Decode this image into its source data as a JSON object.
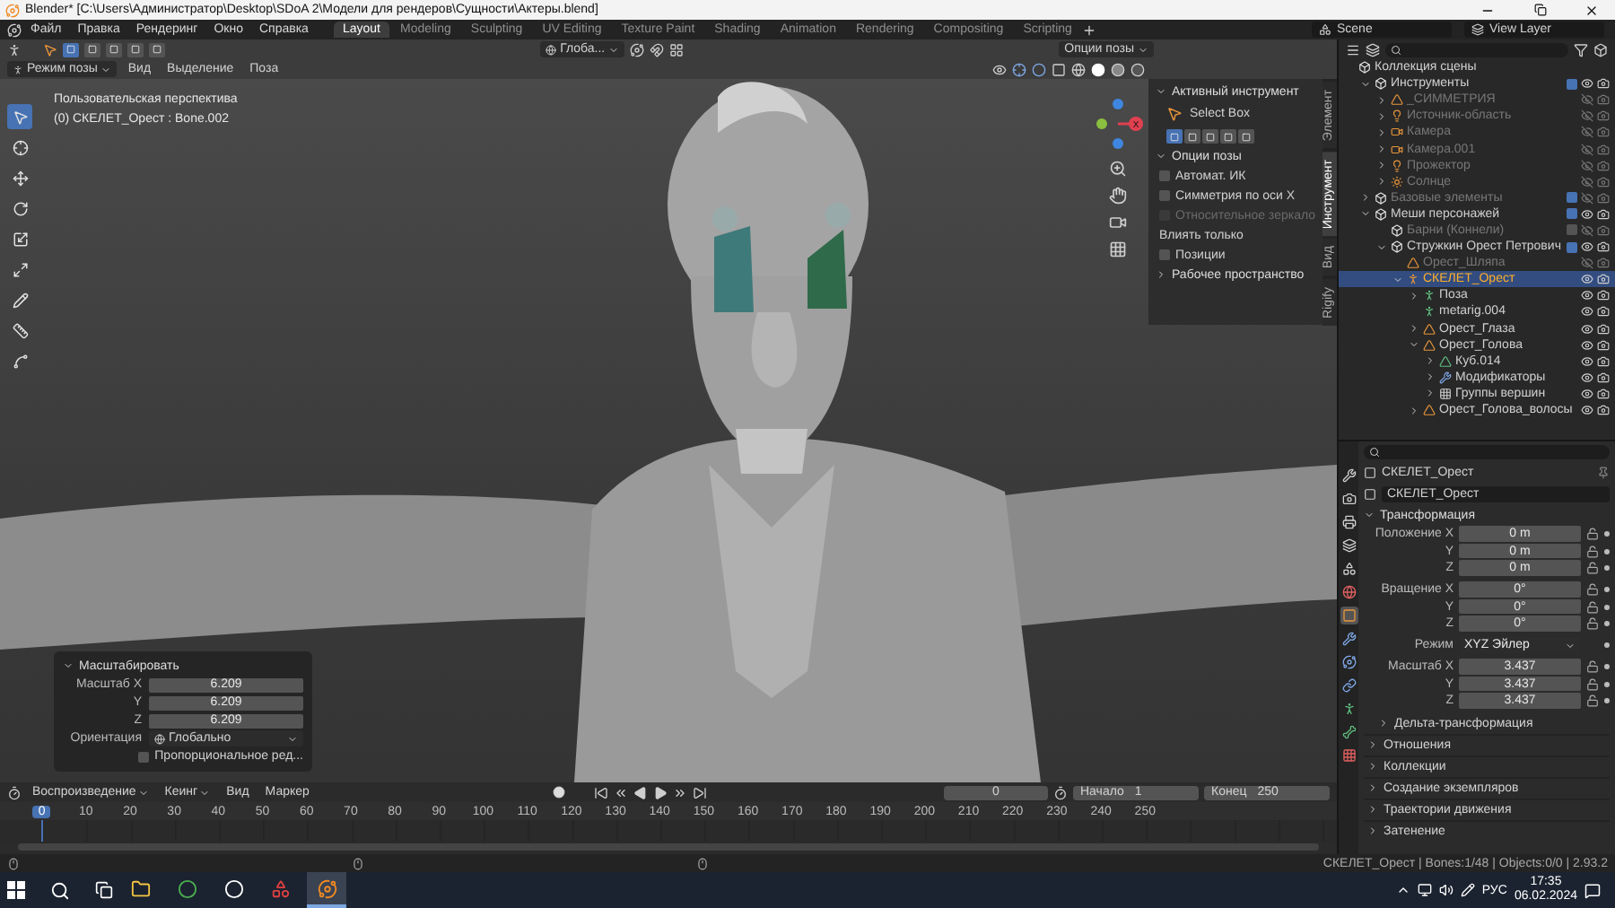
{
  "window": {
    "title": "Blender* [C:\\Users\\Администратор\\Desktop\\SDoA 2\\Модели для рендеров\\Сущности\\Актеры.blend]"
  },
  "menu": [
    "Файл",
    "Правка",
    "Рендеринг",
    "Окно",
    "Справка"
  ],
  "workspaces": [
    {
      "label": "Layout",
      "selected": true
    },
    {
      "label": "Modeling",
      "selected": false
    },
    {
      "label": "Sculpting",
      "selected": false
    },
    {
      "label": "UV Editing",
      "selected": false
    },
    {
      "label": "Texture Paint",
      "selected": false
    },
    {
      "label": "Shading",
      "selected": false
    },
    {
      "label": "Animation",
      "selected": false
    },
    {
      "label": "Rendering",
      "selected": false
    },
    {
      "label": "Compositing",
      "selected": false
    },
    {
      "label": "Scripting",
      "selected": false
    }
  ],
  "scene": "Scene",
  "view_layer": "View Layer",
  "viewport": {
    "select_modes": [
      {
        "selected": true
      },
      {
        "selected": false
      },
      {
        "selected": false
      },
      {
        "selected": false
      },
      {
        "selected": false
      }
    ],
    "orientation": "Глоба...",
    "pose_options": "Опции позы",
    "mode": "Режим позы",
    "menus": [
      "Вид",
      "Выделение",
      "Поза"
    ],
    "overlay_lines": [
      "Пользовательская перспектива",
      "(0) СКЕЛЕТ_Орест : Bone.002"
    ],
    "tools": [
      {
        "kind": "select",
        "selected": true
      },
      {
        "kind": "cursor",
        "selected": false
      },
      {
        "kind": "move",
        "selected": false
      },
      {
        "kind": "rotate",
        "selected": false
      },
      {
        "kind": "scale",
        "selected": false
      },
      {
        "kind": "transform",
        "selected": false
      },
      {
        "kind": "annotate",
        "selected": false
      },
      {
        "kind": "measure",
        "selected": false
      },
      {
        "kind": "roll",
        "selected": false
      }
    ],
    "gizmo_label": "X"
  },
  "sidebar": {
    "tabs": [
      {
        "label": "Элемент",
        "selected": false
      },
      {
        "label": "Инструмент",
        "selected": true
      },
      {
        "label": "Вид",
        "selected": false
      },
      {
        "label": "Rigify",
        "selected": false
      }
    ],
    "active_tool_title": "Активный инструмент",
    "tool_name": "Select Box",
    "tool_modes": [
      {
        "selected": true
      },
      {
        "selected": false
      },
      {
        "selected": false
      },
      {
        "selected": false
      },
      {
        "selected": false
      }
    ],
    "pose_options_title": "Опции позы",
    "options": [
      {
        "kind": "checkbox",
        "label": "Автомат. ИК",
        "checked": false,
        "disabled": false
      },
      {
        "kind": "checkbox",
        "label": "Симметрия по оси X",
        "checked": false,
        "disabled": false
      },
      {
        "kind": "checkbox",
        "label": "Относительное зеркало",
        "checked": false,
        "disabled": true
      },
      {
        "kind": "label",
        "label": "Влиять только"
      },
      {
        "kind": "checkbox",
        "label": "Позиции",
        "checked": false,
        "disabled": false
      }
    ],
    "workspace_title": "Рабочее пространство"
  },
  "last_operation": {
    "title": "Масштабировать",
    "rows": [
      {
        "label": "Масштаб X",
        "value": "6.209"
      },
      {
        "label": "Y",
        "value": "6.209"
      },
      {
        "label": "Z",
        "value": "6.209"
      }
    ],
    "orientation_label": "Ориентация",
    "orientation": "Глобально",
    "proportional": {
      "label": "Пропорциональное ред...",
      "checked": false
    }
  },
  "outliner": {
    "tree": [
      {
        "kind": "collection",
        "label": "Коллекция сцены",
        "selected": false,
        "dimmed": false,
        "children": [
          {
            "kind": "collection",
            "label": "Инструменты",
            "selected": false,
            "dimmed": false,
            "expanded": true,
            "checked": true,
            "children": [
              {
                "kind": "mesh",
                "label": "_СИММЕТРИЯ",
                "selected": false,
                "dimmed": true,
                "expanded": false
              },
              {
                "kind": "light",
                "label": "Источник-область",
                "selected": false,
                "dimmed": true,
                "expanded": false
              },
              {
                "kind": "camera",
                "label": "Камера",
                "selected": false,
                "dimmed": true,
                "expanded": false
              },
              {
                "kind": "camera",
                "label": "Камера.001",
                "selected": false,
                "dimmed": true,
                "expanded": false
              },
              {
                "kind": "light",
                "label": "Прожектор",
                "selected": false,
                "dimmed": true,
                "expanded": false
              },
              {
                "kind": "sun",
                "label": "Солнце",
                "selected": false,
                "dimmed": true,
                "expanded": false
              }
            ]
          },
          {
            "kind": "collection",
            "label": "Базовые элементы",
            "selected": false,
            "dimmed": true,
            "expanded": false,
            "checked": true
          },
          {
            "kind": "collection",
            "label": "Меши персонажей",
            "selected": false,
            "dimmed": false,
            "expanded": true,
            "checked": true,
            "children": [
              {
                "kind": "collection",
                "label": "Барни (Коннели)",
                "selected": false,
                "dimmed": true,
                "checked": false
              },
              {
                "kind": "collection",
                "label": "Стружкин Орест Петрович",
                "selected": false,
                "dimmed": false,
                "expanded": true,
                "checked": true,
                "children": [
                  {
                    "kind": "mesh",
                    "label": "Орест_Шляпа",
                    "selected": false,
                    "dimmed": true
                  },
                  {
                    "kind": "armature",
                    "label": "СКЕЛЕТ_Орест",
                    "selected": true,
                    "dimmed": false,
                    "expanded": true,
                    "children": [
                      {
                        "kind": "pose",
                        "label": "Поза",
                        "selected": false,
                        "dimmed": false,
                        "expanded": false
                      },
                      {
                        "kind": "armature-data",
                        "label": "metarig.004",
                        "selected": false,
                        "dimmed": false
                      },
                      {
                        "kind": "mesh",
                        "label": "Орест_Глаза",
                        "selected": false,
                        "dimmed": false,
                        "expanded": false
                      },
                      {
                        "kind": "mesh",
                        "label": "Орест_Голова",
                        "selected": false,
                        "dimmed": false,
                        "expanded": true,
                        "children": [
                          {
                            "kind": "mesh-data",
                            "label": "Куб.014",
                            "selected": false,
                            "dimmed": false,
                            "expanded": false
                          },
                          {
                            "kind": "modifiers",
                            "label": "Модификаторы",
                            "selected": false,
                            "dimmed": false,
                            "expanded": false
                          },
                          {
                            "kind": "vertex-groups",
                            "label": "Группы вершин",
                            "selected": false,
                            "dimmed": false,
                            "expanded": false
                          }
                        ]
                      },
                      {
                        "kind": "mesh",
                        "label": "Орест_Голова_волосы",
                        "selected": false,
                        "dimmed": false,
                        "expanded": false
                      }
                    ]
                  }
                ]
              }
            ]
          }
        ]
      }
    ]
  },
  "properties": {
    "tabs": [
      {
        "kind": "tool",
        "selected": false
      },
      {
        "kind": "render",
        "selected": false
      },
      {
        "kind": "output",
        "selected": false
      },
      {
        "kind": "view-layer",
        "selected": false
      },
      {
        "kind": "scene",
        "selected": false
      },
      {
        "kind": "world",
        "selected": false
      },
      {
        "kind": "object",
        "selected": true
      },
      {
        "kind": "modifiers",
        "selected": false
      },
      {
        "kind": "physics",
        "selected": false
      },
      {
        "kind": "constraints",
        "selected": false
      },
      {
        "kind": "data",
        "selected": false
      },
      {
        "kind": "bone",
        "selected": false
      },
      {
        "kind": "texture",
        "selected": false
      }
    ],
    "object_name": "СКЕЛЕТ_Орест",
    "datablock": "СКЕЛЕТ_Орест",
    "transform_title": "Трансформация",
    "groups": [
      {
        "rows": [
          {
            "kind": "number",
            "label": "Положение X",
            "value": "0 m"
          },
          {
            "kind": "number",
            "label": "Y",
            "value": "0 m"
          },
          {
            "kind": "number",
            "label": "Z",
            "value": "0 m"
          }
        ]
      },
      {
        "rows": [
          {
            "kind": "number",
            "label": "Вращение X",
            "value": "0°"
          },
          {
            "kind": "number",
            "label": "Y",
            "value": "0°"
          },
          {
            "kind": "number",
            "label": "Z",
            "value": "0°"
          }
        ]
      },
      {
        "rows": [
          {
            "kind": "dropdown",
            "label": "Режим",
            "value": "XYZ Эйлер"
          }
        ]
      },
      {
        "rows": [
          {
            "kind": "number",
            "label": "Масштаб X",
            "value": "3.437"
          },
          {
            "kind": "number",
            "label": "Y",
            "value": "3.437"
          },
          {
            "kind": "number",
            "label": "Z",
            "value": "3.437"
          }
        ]
      }
    ],
    "subpanel": "Дельта-трансформация",
    "panels": [
      "Отношения",
      "Коллекции",
      "Создание экземпляров",
      "Траектории движения",
      "Затенение"
    ]
  },
  "timeline": {
    "menus": [
      {
        "label": "Воспроизведение",
        "dropdown": true
      },
      {
        "label": "Кеинг",
        "dropdown": true
      },
      {
        "label": "Вид",
        "dropdown": false
      },
      {
        "label": "Маркер",
        "dropdown": false
      }
    ],
    "current_frame": "0",
    "start_label": "Начало",
    "start": "1",
    "end_label": "Конец",
    "end": "250",
    "ruler": [
      {
        "label": "0",
        "selected": true
      },
      {
        "label": "10",
        "selected": false
      },
      {
        "label": "20",
        "selected": false
      },
      {
        "label": "30",
        "selected": false
      },
      {
        "label": "40",
        "selected": false
      },
      {
        "label": "50",
        "selected": false
      },
      {
        "label": "60",
        "selected": false
      },
      {
        "label": "70",
        "selected": false
      },
      {
        "label": "80",
        "selected": false
      },
      {
        "label": "90",
        "selected": false
      },
      {
        "label": "100",
        "selected": false
      },
      {
        "label": "110",
        "selected": false
      },
      {
        "label": "120",
        "selected": false
      },
      {
        "label": "130",
        "selected": false
      },
      {
        "label": "140",
        "selected": false
      },
      {
        "label": "150",
        "selected": false
      },
      {
        "label": "160",
        "selected": false
      },
      {
        "label": "170",
        "selected": false
      },
      {
        "label": "180",
        "selected": false
      },
      {
        "label": "190",
        "selected": false
      },
      {
        "label": "200",
        "selected": false
      },
      {
        "label": "210",
        "selected": false
      },
      {
        "label": "220",
        "selected": false
      },
      {
        "label": "230",
        "selected": false
      },
      {
        "label": "240",
        "selected": false
      },
      {
        "label": "250",
        "selected": false
      }
    ]
  },
  "status_bar": {
    "text": "СКЕЛЕТ_Орест | Bones:1/48 | Objects:0/0 | 2.93.2"
  },
  "taskbar": {
    "apps": [
      {
        "kind": "explorer",
        "active": false
      },
      {
        "kind": "browser",
        "active": false
      },
      {
        "kind": "engine",
        "active": false
      },
      {
        "kind": "app",
        "active": false
      },
      {
        "kind": "blender",
        "active": true
      }
    ],
    "language": "РУС",
    "time": "17:35",
    "date": "06.02.2024"
  }
}
